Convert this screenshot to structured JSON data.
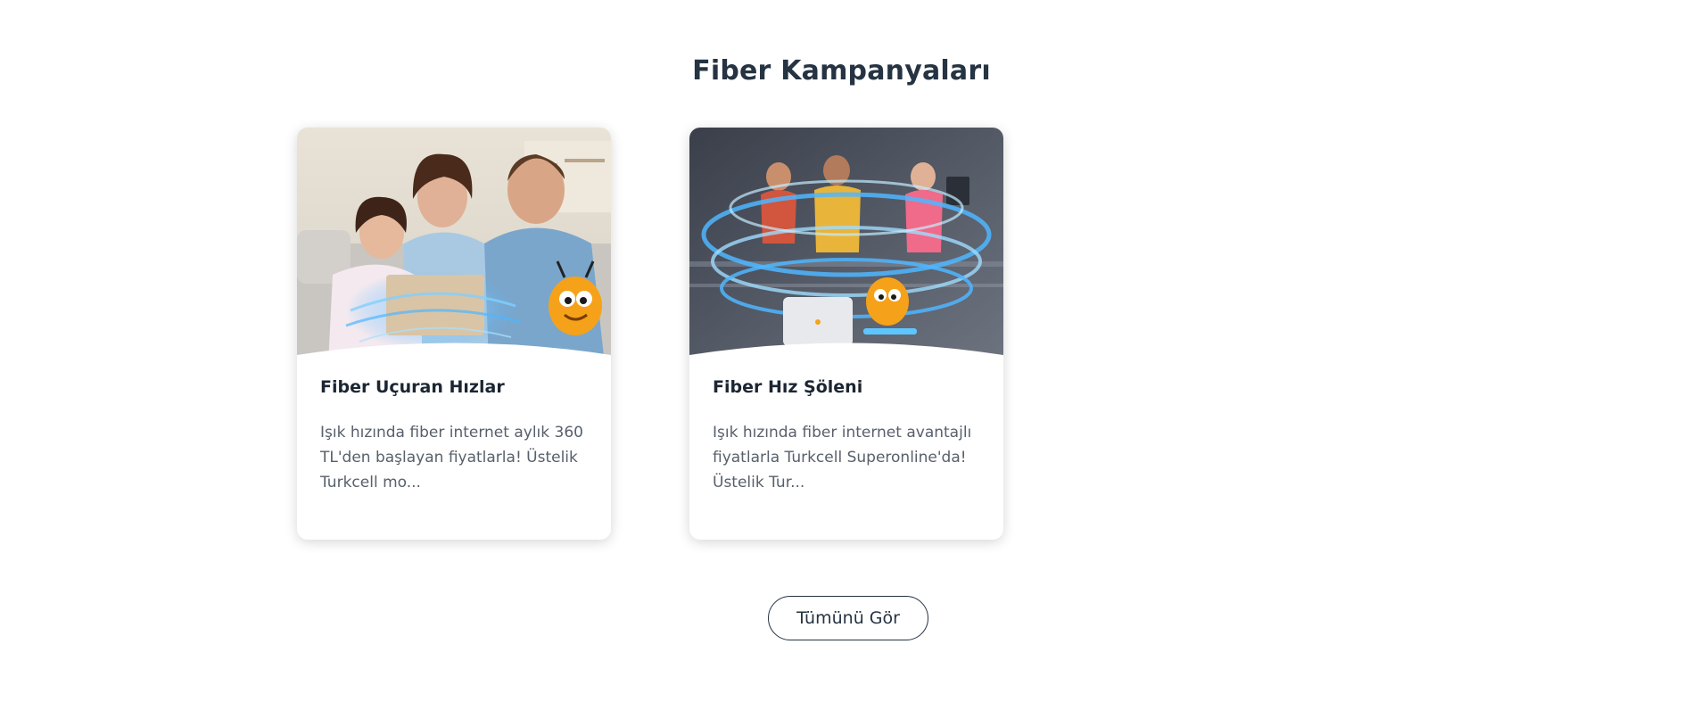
{
  "section": {
    "title": "Fiber Kampanyaları"
  },
  "cards": [
    {
      "title": "Fiber Uçuran Hızlar",
      "description": "Işık hızında fiber internet aylık 360 TL'den başlayan fiyatlarla! Üstelik Turkcell mo...",
      "image": "family-laptop-sofa-mascot"
    },
    {
      "title": "Fiber Hız Şöleni",
      "description": "Işık hızında fiber internet avantajlı fiyatlarla Turkcell Superonline'da! Üstelik Tur...",
      "image": "people-speed-swirl-mascot"
    }
  ],
  "actions": {
    "see_all_label": "Tümünü Gör"
  },
  "colors": {
    "title": "#253342",
    "body_text": "#57606b",
    "button_border": "#253342",
    "speed_glow": "#4fb6ff"
  }
}
